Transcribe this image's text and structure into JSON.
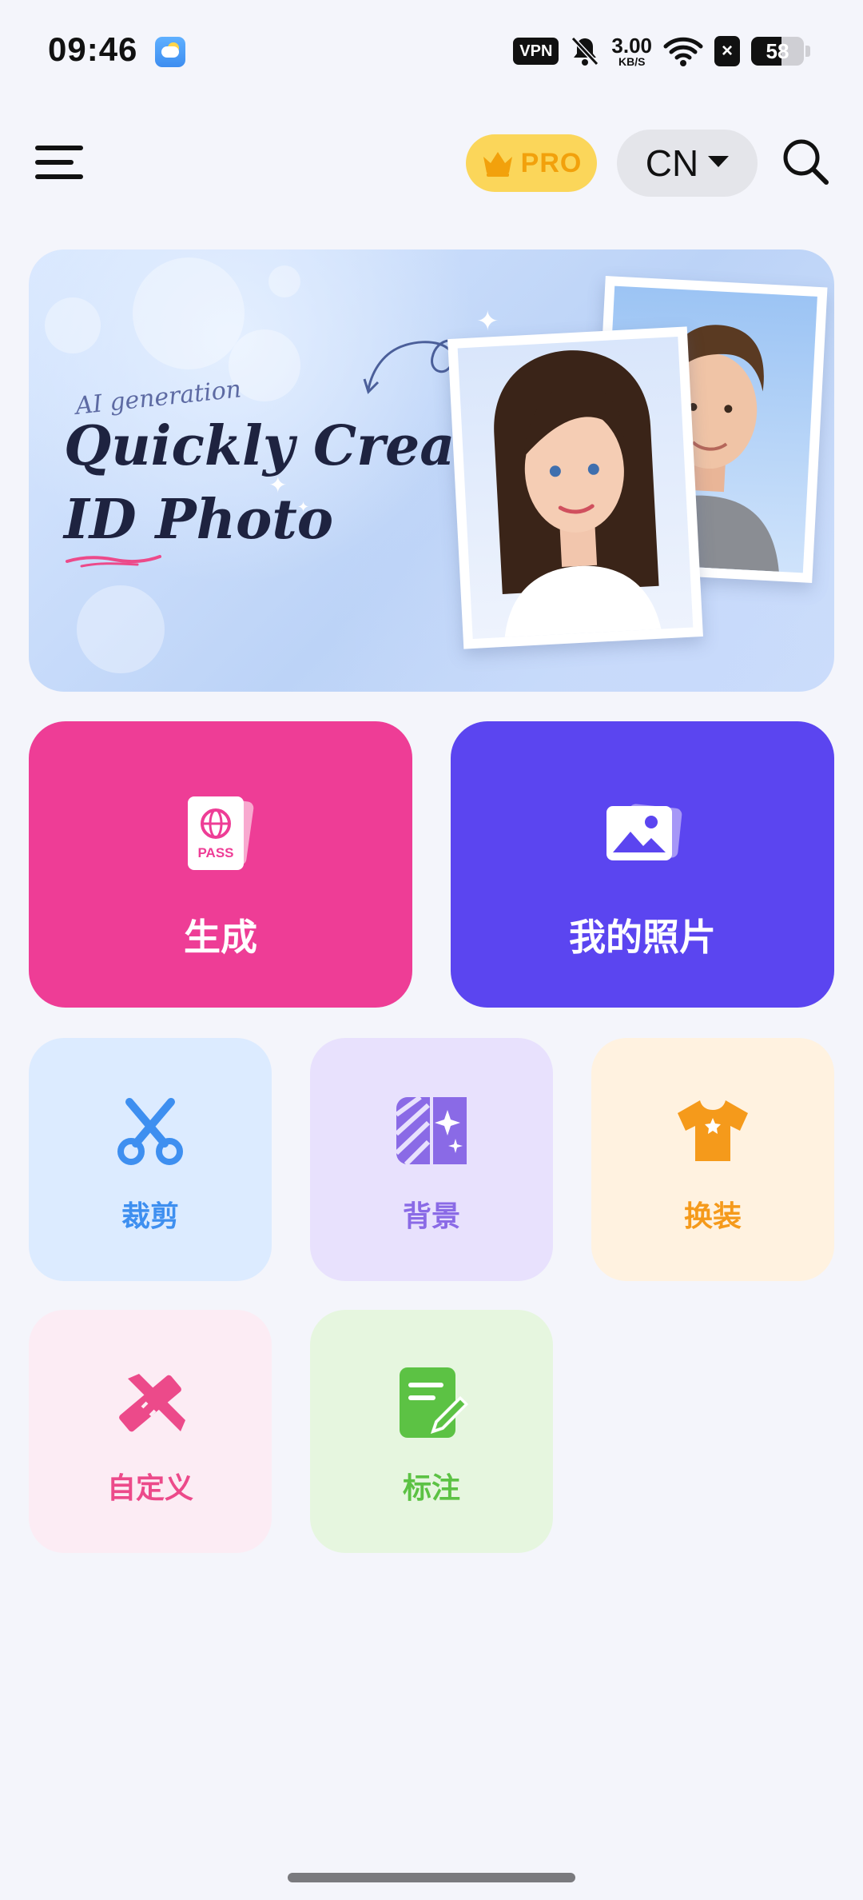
{
  "status_bar": {
    "time": "09:46",
    "vpn": "VPN",
    "speed_value": "3.00",
    "speed_unit": "KB/S",
    "battery": "58",
    "battery_level": 0.58
  },
  "header": {
    "pro_label": "PRO",
    "country": "CN",
    "pro_color": "#fbd65a"
  },
  "banner": {
    "tag": "AI generation",
    "title_line1": "Quickly Create",
    "title_line2": "ID Photo"
  },
  "main_actions": [
    {
      "label": "生成",
      "icon": "passport-icon",
      "color": "#ee3d96"
    },
    {
      "label": "我的照片",
      "icon": "gallery-icon",
      "color": "#5b45f0"
    }
  ],
  "tools": [
    {
      "label": "裁剪",
      "icon": "scissors-icon",
      "bg": "#dcebff",
      "fg": "#3e8ff0"
    },
    {
      "label": "背景",
      "icon": "background-icon",
      "bg": "#e8e1fd",
      "fg": "#8a6ae6"
    },
    {
      "label": "换装",
      "icon": "outfit-icon",
      "bg": "#fff2e0",
      "fg": "#f59a1b"
    },
    {
      "label": "自定义",
      "icon": "ruler-pencil-icon",
      "bg": "#fcecf4",
      "fg": "#ec4a8a"
    },
    {
      "label": "标注",
      "icon": "note-edit-icon",
      "bg": "#e6f6df",
      "fg": "#5cc244"
    }
  ]
}
